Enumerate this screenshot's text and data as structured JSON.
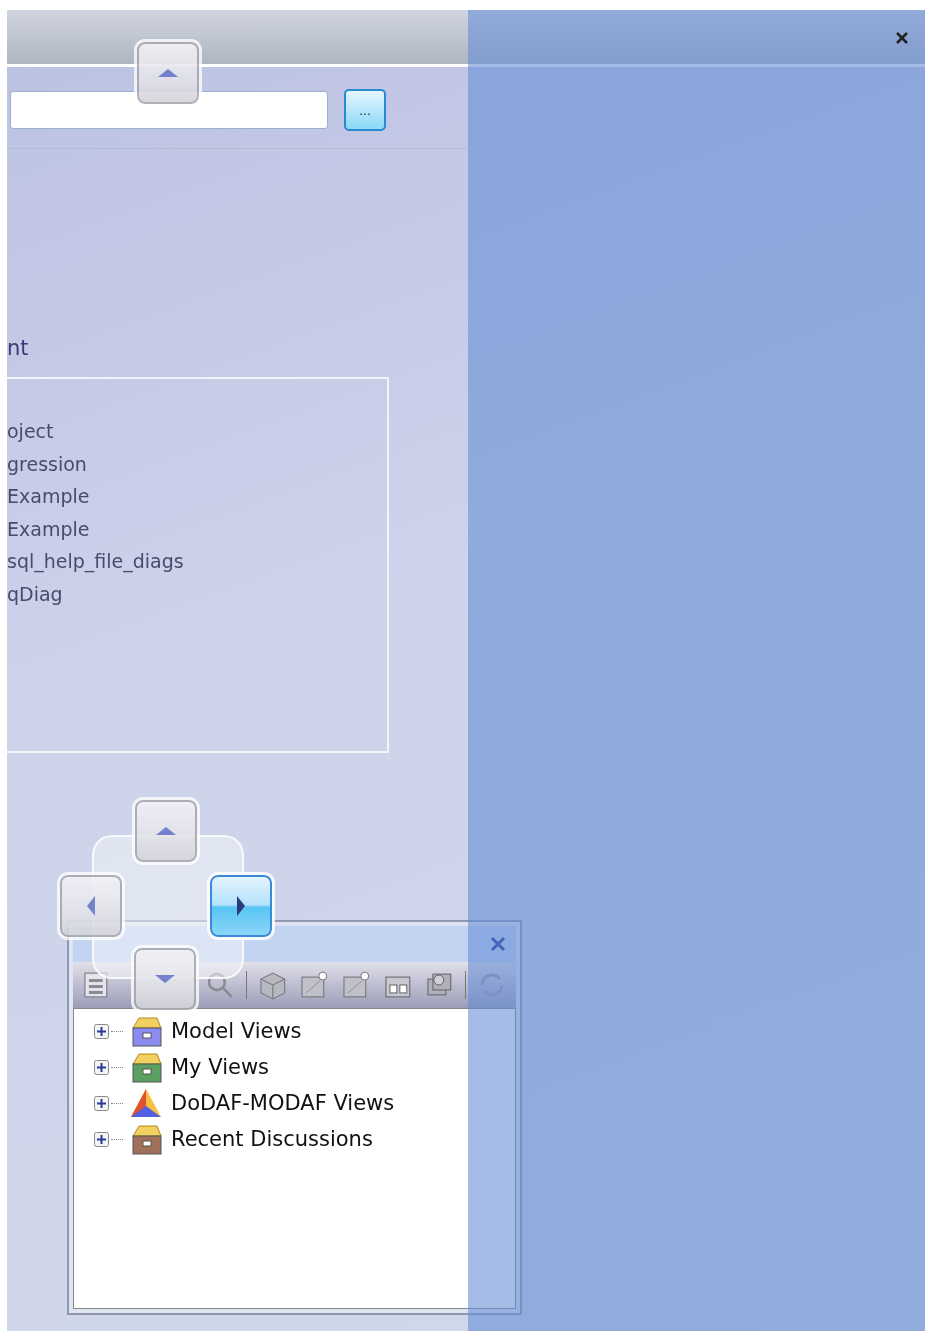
{
  "browse_button": {
    "label": "..."
  },
  "section_label": "nt",
  "list_items": [
    "oject",
    "gression",
    "Example",
    "Example",
    "sql_help_file_diags",
    "qDiag"
  ],
  "model_views_panel": {
    "tree": [
      {
        "label": "Model Views",
        "expanded": false,
        "kind": "cabinet",
        "color": "#8c8cf0"
      },
      {
        "label": "My Views",
        "expanded": false,
        "kind": "cabinet",
        "color": "#5aa060"
      },
      {
        "label": "DoDAF-MODAF Views",
        "expanded": false,
        "kind": "triangle"
      },
      {
        "label": "Recent Discussions",
        "expanded": false,
        "kind": "cabinet",
        "color": "#a0705a"
      }
    ]
  },
  "dock_guide": {
    "edge_targets": [
      {
        "kind": "up",
        "selected": false
      }
    ],
    "center_targets": [
      {
        "kind": "up",
        "selected": false
      },
      {
        "kind": "left",
        "selected": false
      },
      {
        "kind": "right",
        "selected": true
      },
      {
        "kind": "down",
        "selected": false
      }
    ]
  }
}
